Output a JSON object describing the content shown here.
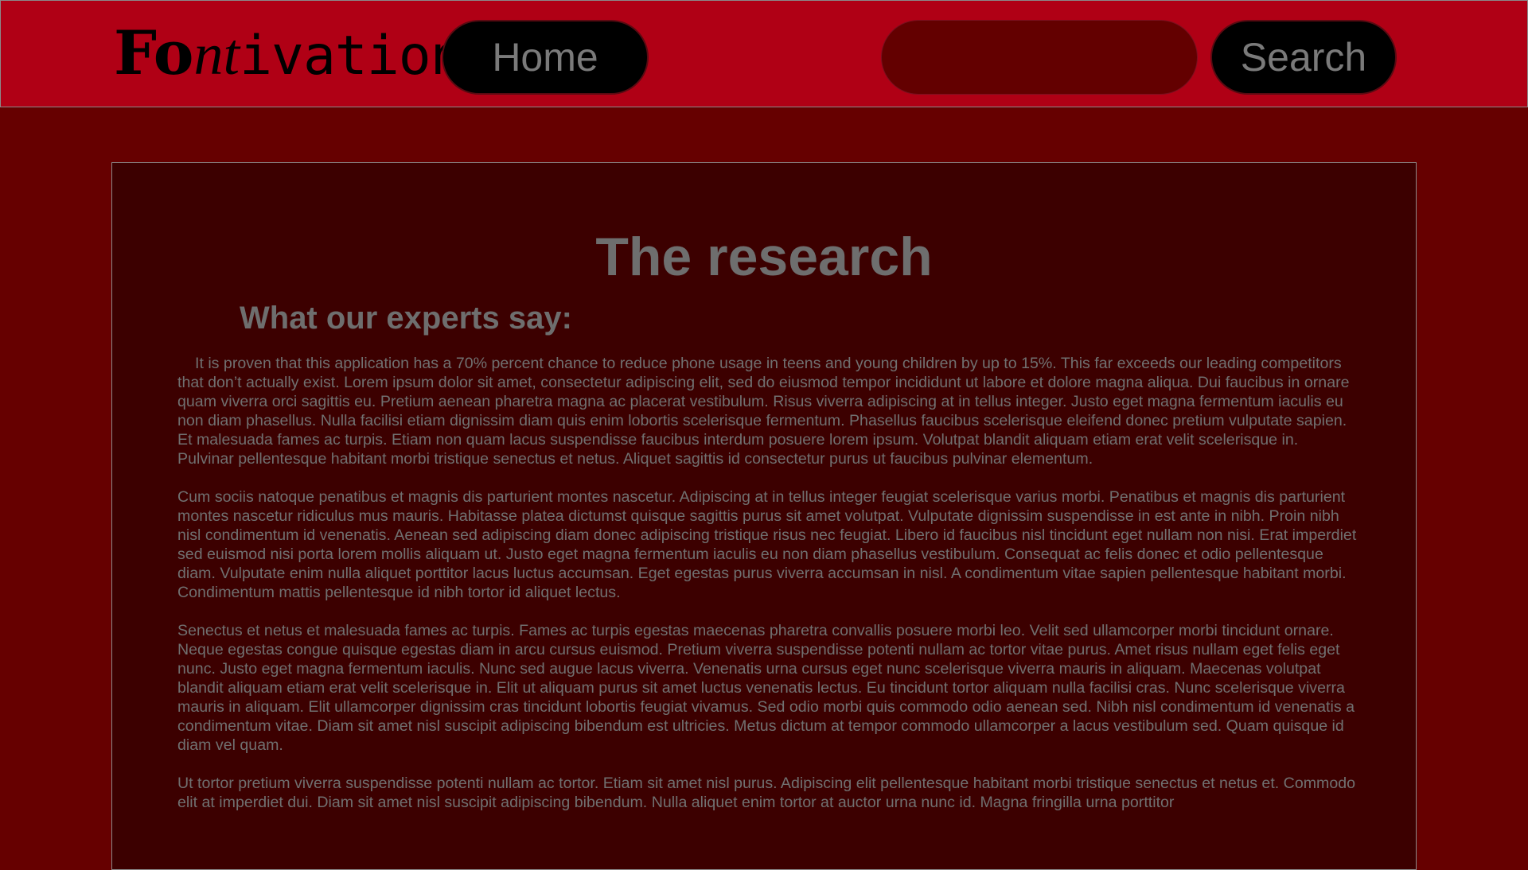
{
  "header": {
    "logo": {
      "part1": "Fo",
      "part2": "nt",
      "part3": "ivation"
    },
    "home_label": "Home",
    "search_value": "",
    "search_label": "Search"
  },
  "main": {
    "title": "The research",
    "subtitle": "What our experts say:",
    "paragraphs": [
      "It is proven that this application has a 70% percent chance to reduce phone usage in teens and young children by up to 15%. This far exceeds our leading competitors that don’t actually exist. Lorem ipsum dolor sit amet, consectetur adipiscing elit, sed do eiusmod tempor incididunt ut labore et dolore magna aliqua. Dui faucibus in ornare quam viverra orci sagittis eu. Pretium aenean pharetra magna ac placerat vestibulum. Risus viverra adipiscing at in tellus integer. Justo eget magna fermentum iaculis eu non diam phasellus. Nulla facilisi etiam dignissim diam quis enim lobortis scelerisque fermentum. Phasellus faucibus scelerisque eleifend donec pretium vulputate sapien. Et malesuada fames ac turpis. Etiam non quam lacus suspendisse faucibus interdum posuere lorem ipsum. Volutpat blandit aliquam etiam erat velit scelerisque in. Pulvinar pellentesque habitant morbi tristique senectus et netus. Aliquet sagittis id consectetur purus ut faucibus pulvinar elementum.",
      "Cum sociis natoque penatibus et magnis dis parturient montes nascetur. Adipiscing at in tellus integer feugiat scelerisque varius morbi. Penatibus et magnis dis parturient montes nascetur ridiculus mus mauris. Habitasse platea dictumst quisque sagittis purus sit amet volutpat. Vulputate dignissim suspendisse in est ante in nibh. Proin nibh nisl condimentum id venenatis. Aenean sed adipiscing diam donec adipiscing tristique risus nec feugiat. Libero id faucibus nisl tincidunt eget nullam non nisi. Erat imperdiet sed euismod nisi porta lorem mollis aliquam ut. Justo eget magna fermentum iaculis eu non diam phasellus vestibulum. Consequat ac felis donec et odio pellentesque diam. Vulputate enim nulla aliquet porttitor lacus luctus accumsan. Eget egestas purus viverra accumsan in nisl. A condimentum vitae sapien pellentesque habitant morbi. Condimentum mattis pellentesque id nibh tortor id aliquet lectus.",
      "Senectus et netus et malesuada fames ac turpis. Fames ac turpis egestas maecenas pharetra convallis posuere morbi leo. Velit sed ullamcorper morbi tincidunt ornare. Neque egestas congue quisque egestas diam in arcu cursus euismod. Pretium viverra suspendisse potenti nullam ac tortor vitae purus. Amet risus nullam eget felis eget nunc. Justo eget magna fermentum iaculis. Nunc sed augue lacus viverra. Venenatis urna cursus eget nunc scelerisque viverra mauris in aliquam. Maecenas volutpat blandit aliquam etiam erat velit scelerisque in. Elit ut aliquam purus sit amet luctus venenatis lectus. Eu tincidunt tortor aliquam nulla facilisi cras. Nunc scelerisque viverra mauris in aliquam. Elit ullamcorper dignissim cras tincidunt lobortis feugiat vivamus. Sed odio morbi quis commodo odio aenean sed. Nibh nisl condimentum id venenatis a condimentum vitae. Diam sit amet nisl suscipit adipiscing bibendum est ultricies. Metus dictum at tempor commodo ullamcorper a lacus vestibulum sed. Quam quisque id diam vel quam.",
      "Ut tortor pretium viverra suspendisse potenti nullam ac tortor. Etiam sit amet nisl purus. Adipiscing elit pellentesque habitant morbi tristique senectus et netus et. Commodo elit at imperdiet dui. Diam sit amet nisl suscipit adipiscing bibendum. Nulla aliquet enim tortor at auctor urna nunc id. Magna fringilla urna porttitor"
    ]
  },
  "colors": {
    "page_background": "#660000",
    "header_background": "#b00015",
    "content_background": "#3c0000",
    "button_background": "#000000",
    "text_gray": "#707070"
  }
}
